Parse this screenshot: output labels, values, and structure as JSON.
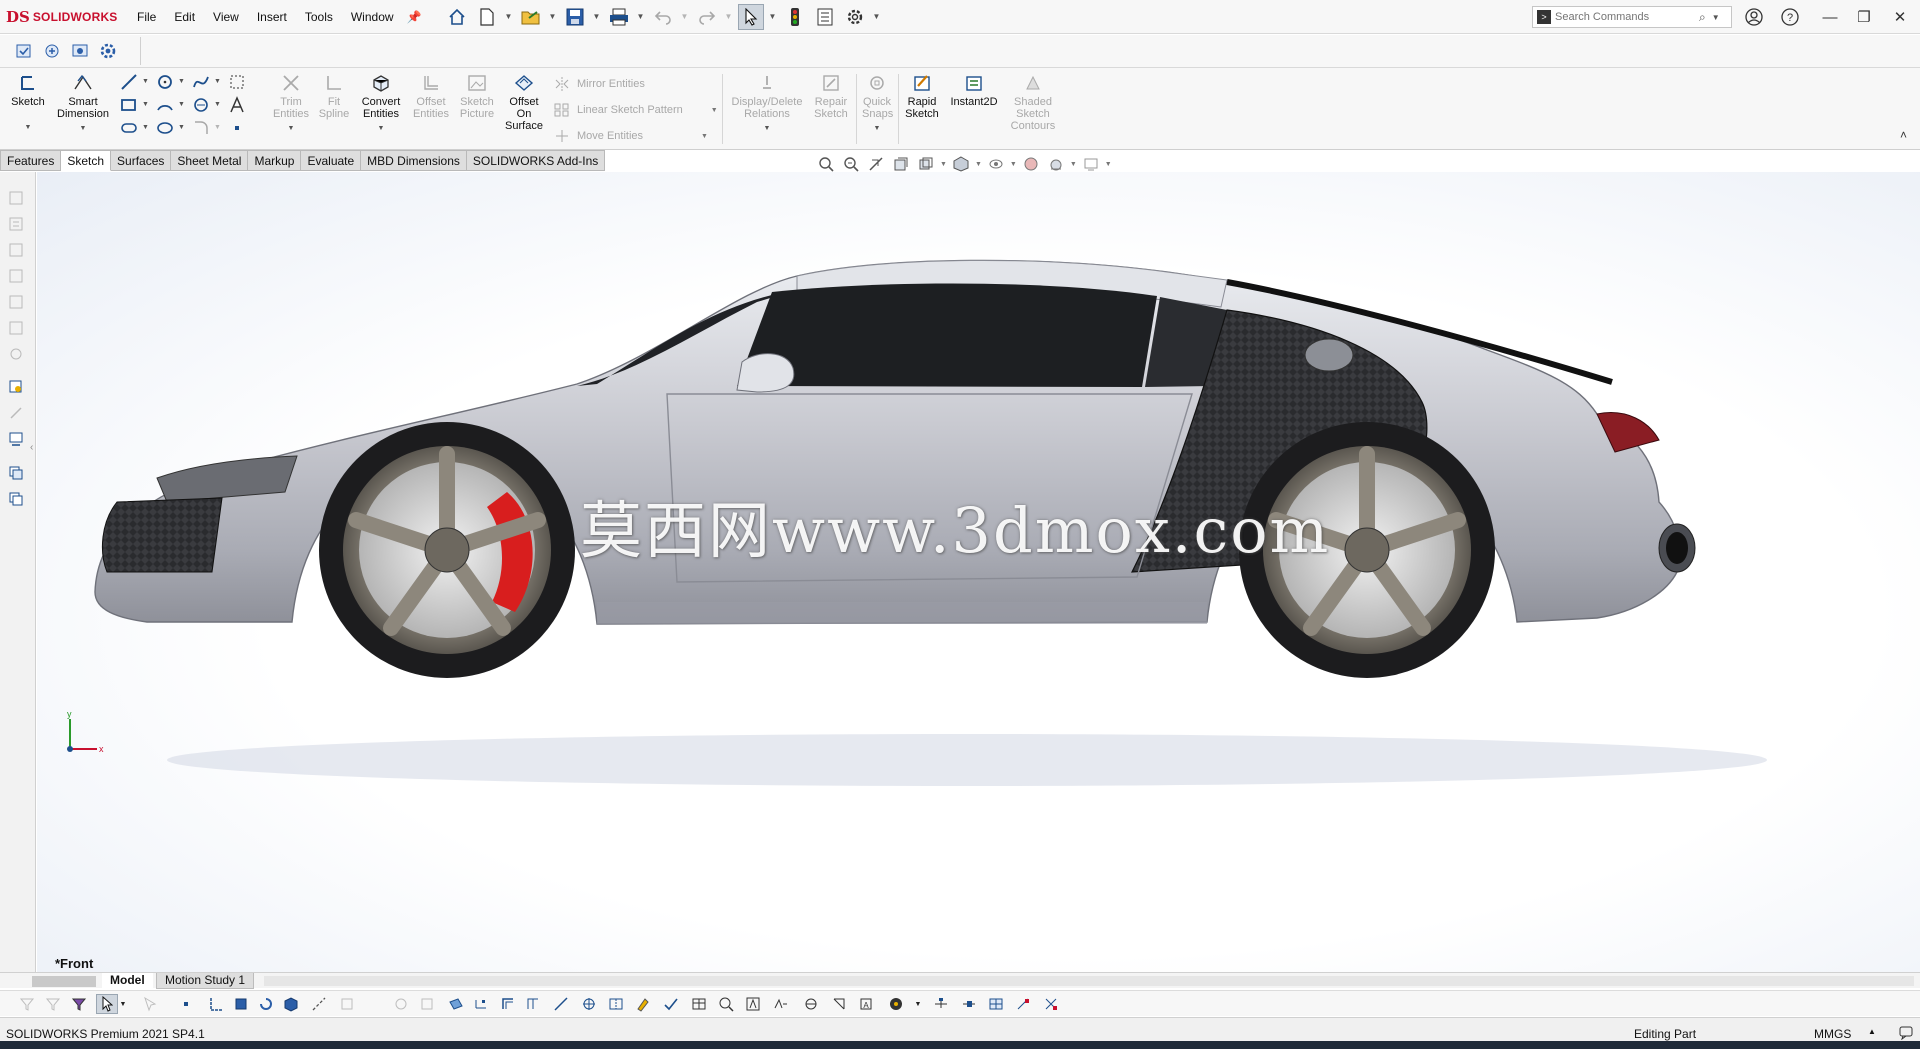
{
  "app": {
    "brand": "SOLIDWORKS",
    "logo_mark": "DS",
    "accent_color": "#c8102e",
    "version_text": "SOLIDWORKS Premium 2021 SP4.1"
  },
  "menu": [
    "File",
    "Edit",
    "View",
    "Insert",
    "Tools",
    "Window"
  ],
  "quick_access_icons": [
    "home-icon",
    "new-document-icon",
    "open-folder-icon",
    "save-icon",
    "print-icon",
    "undo-icon",
    "redo-icon",
    "select-pointer-icon",
    "traffic-light-icon",
    "file-properties-icon",
    "options-gear-icon"
  ],
  "search": {
    "placeholder": "Search Commands"
  },
  "window_controls": [
    "user-icon",
    "help-icon",
    "minimize-icon",
    "restore-icon",
    "close-icon"
  ],
  "command_manager": {
    "sketch_label": "Sketch",
    "smart_dimension_label": "Smart Dimension",
    "trim_label": "Trim Entities",
    "fit_spline_label": "Fit Spline",
    "convert_label": "Convert Entities",
    "offset_label": "Offset Entities",
    "sketch_picture_label": "Sketch Picture",
    "offset_surface_label": "Offset On Surface",
    "mirror_label": "Mirror Entities",
    "linear_pattern_label": "Linear Sketch Pattern",
    "move_label": "Move Entities",
    "display_relations_label": "Display/Delete Relations",
    "repair_label": "Repair Sketch",
    "quick_snaps_label": "Quick Snaps",
    "rapid_sketch_label": "Rapid Sketch",
    "instant2d_label": "Instant2D",
    "shaded_contours_label": "Shaded Sketch Contours"
  },
  "tabs": [
    {
      "label": "Features",
      "active": false
    },
    {
      "label": "Sketch",
      "active": true
    },
    {
      "label": "Surfaces",
      "active": false
    },
    {
      "label": "Sheet Metal",
      "active": false
    },
    {
      "label": "Markup",
      "active": false
    },
    {
      "label": "Evaluate",
      "active": false
    },
    {
      "label": "MBD Dimensions",
      "active": false
    },
    {
      "label": "SOLIDWORKS Add-Ins",
      "active": false
    }
  ],
  "viewport": {
    "view_name": "*Front",
    "watermark": "莫西网www.3dmox.com",
    "axis_x_label": "x",
    "axis_y_label": "y",
    "caliper_color": "#d81e1e",
    "body_color": "#c9cad1"
  },
  "bottom_tabs": {
    "model_label": "Model",
    "motion_label": "Motion Study 1"
  },
  "status": {
    "left": "SOLIDWORKS Premium 2021 SP4.1",
    "editing": "Editing Part",
    "units": "MMGS"
  }
}
